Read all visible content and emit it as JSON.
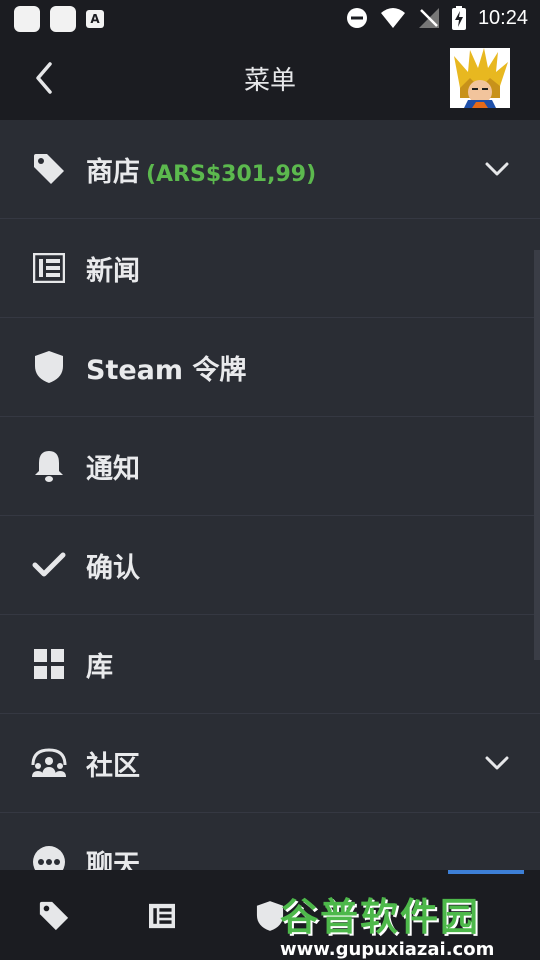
{
  "status_bar": {
    "time": "10:24",
    "badge_letter": "A"
  },
  "header": {
    "title": "菜单"
  },
  "menu": {
    "items": [
      {
        "label": "商店",
        "price": "(ARS$301,99)",
        "icon": "tag-icon",
        "expandable": true
      },
      {
        "label": "新闻",
        "icon": "newspaper-icon",
        "expandable": false
      },
      {
        "label": "Steam 令牌",
        "icon": "shield-icon",
        "expandable": false
      },
      {
        "label": "通知",
        "icon": "bell-icon",
        "expandable": false
      },
      {
        "label": "确认",
        "icon": "check-icon",
        "expandable": false
      },
      {
        "label": "库",
        "icon": "grid-icon",
        "expandable": false
      },
      {
        "label": "社区",
        "icon": "community-icon",
        "expandable": true
      },
      {
        "label": "聊天",
        "icon": "chat-icon",
        "expandable": false
      }
    ]
  },
  "bottom_nav": {
    "items": [
      "tag-icon",
      "newspaper-icon",
      "shield-icon"
    ]
  },
  "watermark": {
    "main": "谷普软件园",
    "url": "www.gupuxiazai.com"
  },
  "colors": {
    "bg": "#2a2d34",
    "header": "#1b1c21",
    "price": "#5cb94e",
    "accent": "#3d7fd6"
  }
}
